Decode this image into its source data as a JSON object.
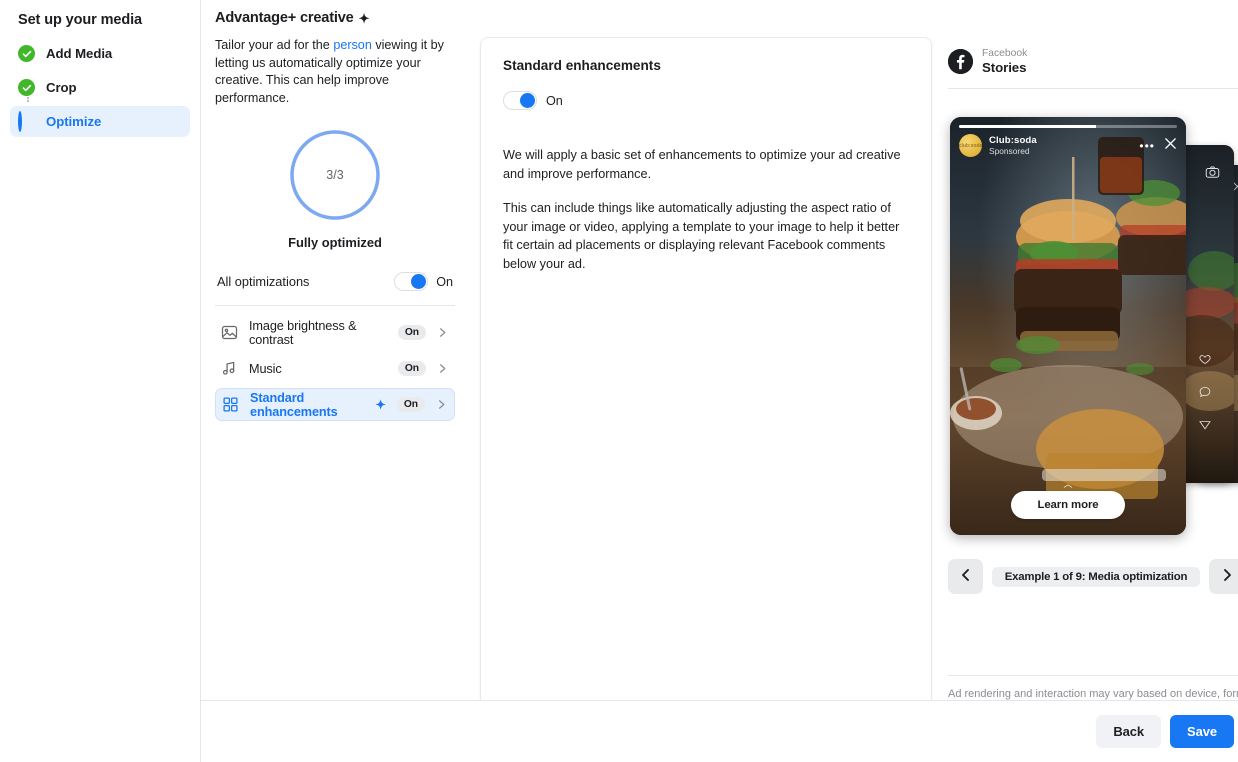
{
  "sidebar": {
    "title": "Set up your media",
    "steps": [
      {
        "label": "Add Media",
        "icon": "check-circle-icon",
        "state": "complete"
      },
      {
        "label": "Crop",
        "icon": "check-circle-icon",
        "state": "complete"
      },
      {
        "label": "Optimize",
        "icon": "half-circle-icon",
        "state": "active"
      }
    ]
  },
  "detail": {
    "title": "Advantage+ creative",
    "title_sparkle": "✦",
    "description_pre": "Tailor your ad for the ",
    "description_link": "person",
    "description_post": " viewing it by letting us automatically optimize your creative. This can help improve performance.",
    "ring": {
      "value": "3/3",
      "caption": "Fully optimized",
      "percent": 100
    },
    "all_optimizations": {
      "label": "All optimizations",
      "toggle_state": "On"
    },
    "options": [
      {
        "label": "Image brightness & contrast",
        "icon": "image-icon",
        "status": "On",
        "selected": false,
        "sparkle": ""
      },
      {
        "label": "Music",
        "icon": "music-note-icon",
        "status": "On",
        "selected": false,
        "sparkle": ""
      },
      {
        "label": "Standard enhancements",
        "icon": "grid-squares-icon",
        "status": "On",
        "selected": true,
        "sparkle": "✦"
      }
    ]
  },
  "center": {
    "title": "Standard enhancements",
    "toggle_state": "On",
    "paragraphs": [
      "We will apply a basic set of enhancements to optimize your ad creative and improve performance.",
      "This can include things like automatically adjusting the aspect ratio of your image or video, applying a template to your image to help it better fit certain ad placements or displaying relevant Facebook comments below your ad."
    ]
  },
  "preview": {
    "platform": "Facebook",
    "surface": "Stories",
    "story": {
      "brand": "Club:soda",
      "sponsored": "Sponsored",
      "avatar_text": "club:soda",
      "cta": "Learn more",
      "menu_icon": "ellipsis-icon",
      "close_icon": "close-icon"
    },
    "pager": {
      "prev_icon": "chevron-left-icon",
      "next_icon": "chevron-right-icon",
      "label": "Example 1 of 9: Media optimization"
    },
    "footer_note": "Ad rendering and interaction may vary based on device, form..."
  },
  "footer": {
    "back_label": "Back",
    "save_label": "Save"
  },
  "window": {
    "close_icon": "close-icon"
  },
  "colors": {
    "accent": "#1877f2",
    "success": "#42b72a",
    "selected_bg": "#e7f0fd",
    "text": "#1c1e21",
    "muted": "#8a8d91"
  }
}
